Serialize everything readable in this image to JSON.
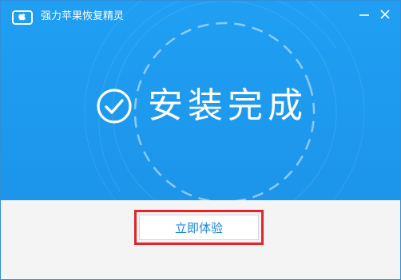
{
  "window": {
    "title": "强力苹果恢复精灵",
    "accent_color": "#1d9bf0",
    "footer_color": "#f4f4f4"
  },
  "titlebar": {
    "app_icon": "app-logo-icon",
    "minimize_icon": "minimize-icon",
    "close_icon": "close-icon"
  },
  "status": {
    "icon": "check-circle-icon",
    "text": "安装完成"
  },
  "footer": {
    "primary_button_label": "立即体验",
    "highlight_color": "#e0262c"
  }
}
